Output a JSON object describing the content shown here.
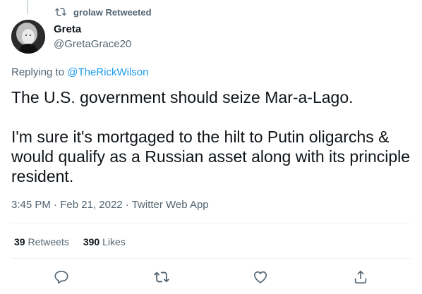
{
  "retweet_context": {
    "text": "grolaw Retweeted",
    "icon": "retweet-icon"
  },
  "author": {
    "name": "Greta",
    "handle": "@GretaGrace20",
    "avatar": "avatar-photo"
  },
  "replying_to": {
    "prefix": "Replying to ",
    "user": "@TheRickWilson"
  },
  "tweet": {
    "paragraph_1": "The U.S. government should seize Mar-a-Lago.",
    "paragraph_2": "I'm sure it's mortgaged to the hilt to Putin oligarchs & would qualify as a Russian asset along with its principle resident."
  },
  "meta": {
    "time": "3:45 PM",
    "separator": " · ",
    "date": "Feb 21, 2022",
    "source": "Twitter Web App"
  },
  "stats": {
    "retweets_count": "39",
    "retweets_label": "Retweets",
    "likes_count": "390",
    "likes_label": "Likes"
  },
  "actions": [
    "reply-icon",
    "retweet-icon",
    "like-icon",
    "share-icon"
  ],
  "colors": {
    "link": "#1d9bf0",
    "secondary_text": "#536471",
    "primary_text": "#0f1419",
    "divider": "#eff3f4"
  }
}
